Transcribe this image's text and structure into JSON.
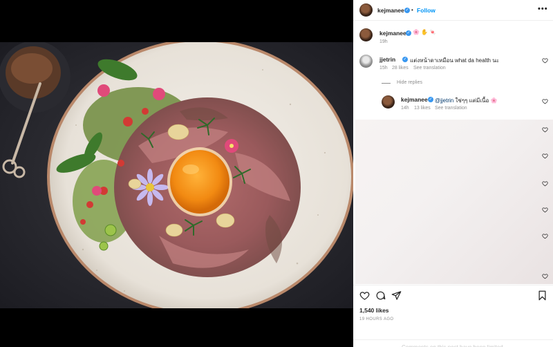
{
  "post": {
    "username": "kejmanee",
    "follow_label": "Follow",
    "separator": "•",
    "more_label": "•••",
    "caption_emojis": "🌸 ✋ 🍬",
    "caption_time": "19h"
  },
  "comments": [
    {
      "username": "jjetrin",
      "text": "แต่งหน้าดาเหมือน what da health นะ",
      "time": "15h",
      "likes": "28 likes",
      "translate": "See translation",
      "hide_replies": "Hide replies"
    }
  ],
  "reply": {
    "username": "kejmanee",
    "mention": "@jjetrin",
    "text": "ใช่ๆๆ แต่มีเนื้อ 🌸",
    "time": "14h",
    "likes": "13 likes",
    "translate": "See translation"
  },
  "footer": {
    "likes": "1,540 likes",
    "time_ago": "19 HOURS AGO",
    "comments_limited": "Comments on this post have been limited."
  },
  "colors": {
    "accent": "#0095f6",
    "verified": "#3897f0",
    "muted": "#8e8e8e"
  }
}
